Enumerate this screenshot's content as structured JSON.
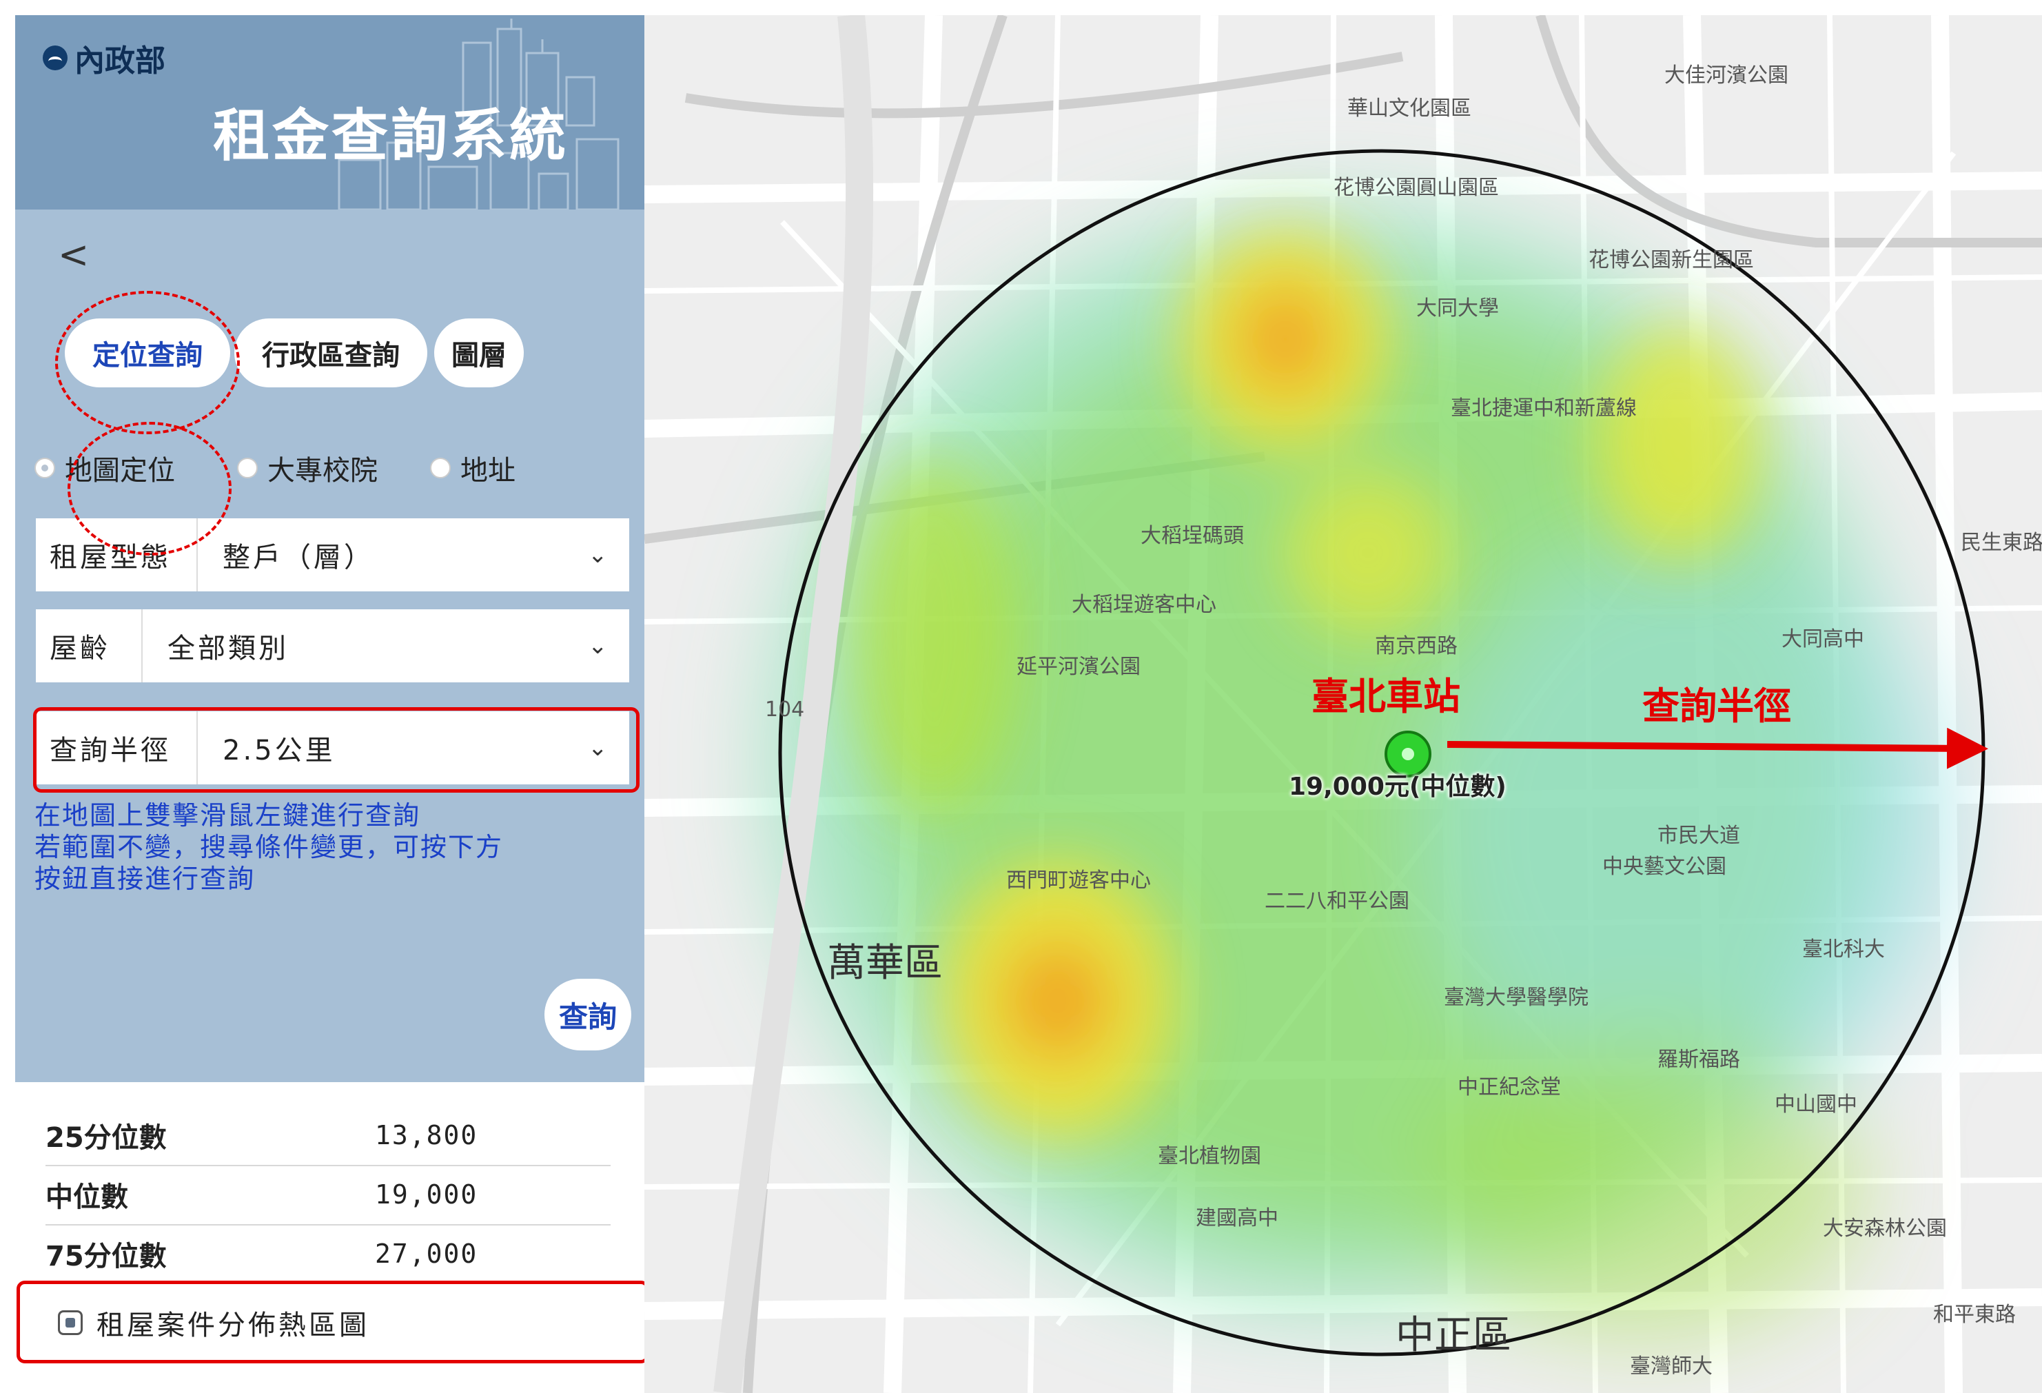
{
  "header": {
    "logo_text": "內政部",
    "title": "租金查詢系統"
  },
  "back_label": "<",
  "tabs": [
    {
      "label": "定位查詢",
      "selected": true
    },
    {
      "label": "行政區查詢",
      "selected": false
    },
    {
      "label": "圖層",
      "selected": false
    }
  ],
  "location_modes": [
    {
      "label": "地圖定位",
      "checked": true
    },
    {
      "label": "大專校院",
      "checked": false
    },
    {
      "label": "地址",
      "checked": false
    }
  ],
  "filters": {
    "rental_type": {
      "label": "租屋型態",
      "value": "整戶（層）"
    },
    "building_age": {
      "label": "屋齡",
      "value": "全部類別"
    },
    "radius": {
      "label": "查詢半徑",
      "value": "2.5公里"
    }
  },
  "hint_lines": [
    "在地圖上雙擊滑鼠左鍵進行查詢",
    "若範圍不變，搜尋條件變更，可按下方",
    "按鈕直接進行查詢"
  ],
  "query_button": "查詢",
  "stats": [
    {
      "label": "25分位數",
      "value": "13,800"
    },
    {
      "label": "中位數",
      "value": "19,000"
    },
    {
      "label": "75分位數",
      "value": "27,000"
    }
  ],
  "heatmap_toggle": {
    "label": "租屋案件分佈熱區圖",
    "checked": true
  },
  "map": {
    "station_label": "臺北車站",
    "radius_label": "查詢半徑",
    "median_label": "19,000元(中位數)",
    "labels": {
      "wanhua": "萬華區",
      "zhongzheng": "中正區",
      "datong_univ": "大同大學",
      "dadaocheng": "大稻埕碼頭",
      "dadaocheng_center": "大稻埕遊客中心",
      "ntu_hospital": "臺灣大學醫學院",
      "peace_park": "二二八和平公園",
      "cks_memorial": "中正紀念堂",
      "botanical": "臺北植物園",
      "jianguo_hs": "建國高中",
      "ntnu": "臺灣師大",
      "datong_hs": "大同高中",
      "ximen": "西門町遊客中心",
      "huashan": "華山文化園區",
      "zhongshan_ms": "中山國中",
      "roosevelt": "羅斯福路",
      "hwy_104": "104",
      "metro_line": "臺北捷運中和新蘆線",
      "civic_blvd": "市民大道",
      "minsheng_e": "民生東路",
      "zhongyang": "中央藝文公園",
      "ntust": "臺北科大",
      "daan_park": "大安森林公園",
      "heping_e": "和平東路",
      "yanping_park": "延平河濱公園",
      "nanjing_w": "南京西路",
      "xinsheng_park": "花博公園新生園區",
      "yuanshan": "花博公園圓山園區",
      "dajia_park": "大佳河濱公園"
    }
  },
  "colors": {
    "accent": "#e30000",
    "link": "#1d46b8",
    "header_bg": "#7a9cbc",
    "sidebar_bg": "#a7bfd6"
  }
}
